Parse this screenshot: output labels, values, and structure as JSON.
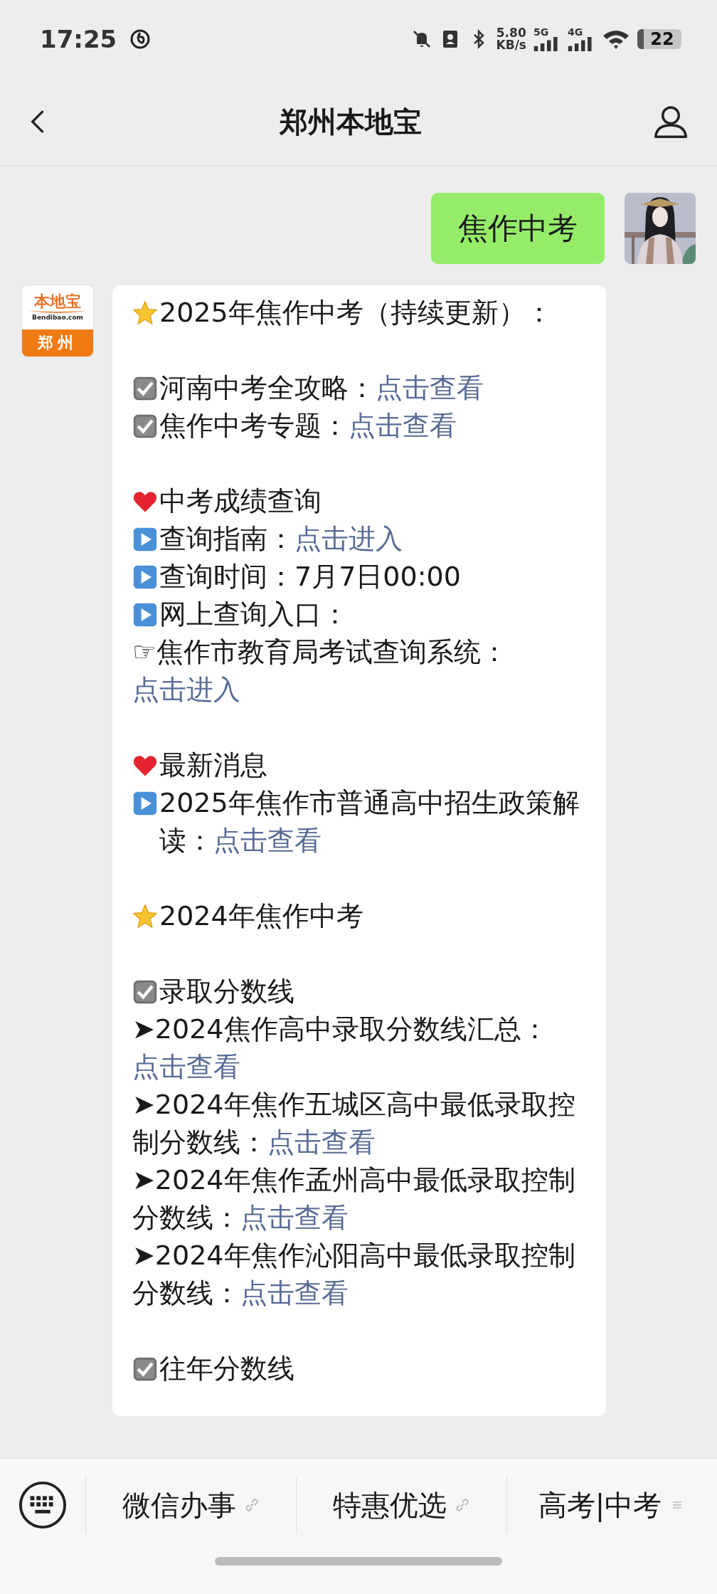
{
  "status_bar": {
    "time": "17:25",
    "net_speed_value": "5.80",
    "net_speed_unit": "KB/s",
    "signal_1": "5G",
    "signal_2": "4G",
    "battery": "22"
  },
  "header": {
    "title": "郑州本地宝"
  },
  "messages": [
    {
      "kind": "outgoing",
      "text": "焦作中考"
    },
    {
      "kind": "incoming",
      "logo": {
        "name": "本地宝",
        "site": "Bendibao.com",
        "city": "郑州"
      },
      "paragraphs": [
        [
          {
            "kind": "star",
            "text": "2025年焦作中考（持续更新）："
          }
        ],
        [
          {
            "kind": "check",
            "text": "河南中考全攻略：",
            "link": "点击查看"
          },
          {
            "kind": "check",
            "text": "焦作中考专题：",
            "link": "点击查看"
          }
        ],
        [
          {
            "kind": "heart",
            "text": "中考成绩查询"
          },
          {
            "kind": "play",
            "text": "查询指南：",
            "link": "点击进入"
          },
          {
            "kind": "play",
            "text": "查询时间：7月7日00:00"
          },
          {
            "kind": "play",
            "text": "网上查询入口："
          },
          {
            "text": "☞焦作市教育局考试查询系统：",
            "link": "点击进入"
          }
        ],
        [
          {
            "kind": "heart",
            "text": "最新消息"
          },
          {
            "kind": "play",
            "text": "2025年焦作市普通高中招生政策解读：",
            "link": "点击查看"
          }
        ],
        [
          {
            "kind": "star",
            "text": "2024年焦作中考"
          }
        ],
        [
          {
            "kind": "check",
            "text": "录取分数线"
          },
          {
            "text": "➤2024焦作高中录取分数线汇总：",
            "link": "点击查看"
          },
          {
            "text": "➤2024年焦作五城区高中最低录取控制分数线：",
            "link": "点击查看"
          },
          {
            "text": "➤2024年焦作孟州高中最低录取控制分数线：",
            "link": "点击查看"
          },
          {
            "text": "➤2024年焦作沁阳高中最低录取控制分数线：",
            "link": "点击查看"
          }
        ],
        [
          {
            "kind": "check",
            "text": "往年分数线"
          }
        ]
      ]
    }
  ],
  "menu_bar": {
    "items": [
      {
        "label": "微信办事",
        "kind": "link"
      },
      {
        "label": "特惠优选",
        "kind": "link"
      },
      {
        "label": "高考|中考",
        "kind": "menu"
      }
    ]
  }
}
